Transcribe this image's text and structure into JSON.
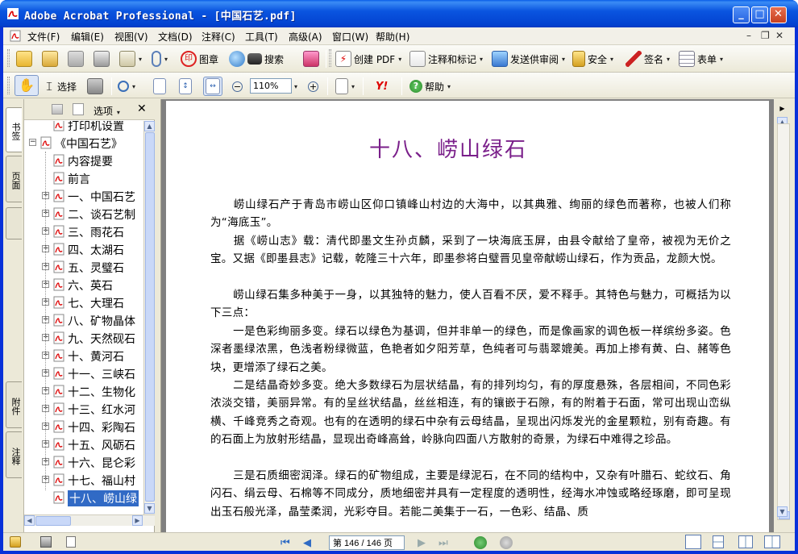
{
  "window": {
    "title": "Adobe Acrobat Professional - [中国石艺.pdf]",
    "controls": {
      "minimize": "_",
      "maximize": "□",
      "close": "✕"
    }
  },
  "menubar": {
    "items": [
      "文件(F)",
      "编辑(E)",
      "视图(V)",
      "文档(D)",
      "注释(C)",
      "工具(T)",
      "高级(A)",
      "窗口(W)",
      "帮助(H)"
    ],
    "mdi_controls": {
      "minimize": "–",
      "restore": "❐",
      "close": "✕"
    }
  },
  "toolbar1": {
    "stamp_label": "图章",
    "search_label": "搜索",
    "create_pdf_label": "创建 PDF",
    "comment_label": "注释和标记",
    "review_label": "发送供审阅",
    "secure_label": "安全",
    "sign_label": "签名",
    "forms_label": "表单"
  },
  "toolbar2": {
    "select_label": "选择",
    "zoom_value": "110%",
    "help_label": "帮助",
    "yahoo_label": "Y!"
  },
  "sidebar_tabs": [
    "书签",
    "页面",
    "附件",
    "注释"
  ],
  "navpane": {
    "options_label": "选项",
    "close_label": "✕",
    "tree": [
      {
        "label": "打印机设置",
        "indent": 1,
        "expander": "",
        "partial": true
      },
      {
        "label": "《中国石艺》",
        "indent": 0,
        "expander": "−"
      },
      {
        "label": "内容提要",
        "indent": 1,
        "expander": ""
      },
      {
        "label": "前言",
        "indent": 1,
        "expander": ""
      },
      {
        "label": "一、中国石艺",
        "indent": 1,
        "expander": "+"
      },
      {
        "label": "二、谈石艺制",
        "indent": 1,
        "expander": "+"
      },
      {
        "label": "三、雨花石",
        "indent": 1,
        "expander": "+"
      },
      {
        "label": "四、太湖石",
        "indent": 1,
        "expander": "+"
      },
      {
        "label": "五、灵璧石",
        "indent": 1,
        "expander": "+"
      },
      {
        "label": "六、英石",
        "indent": 1,
        "expander": "+"
      },
      {
        "label": "七、大理石",
        "indent": 1,
        "expander": "+"
      },
      {
        "label": "八、矿物晶体",
        "indent": 1,
        "expander": "+"
      },
      {
        "label": "九、天然砚石",
        "indent": 1,
        "expander": "+"
      },
      {
        "label": "十、黄河石",
        "indent": 1,
        "expander": "+"
      },
      {
        "label": "十一、三峡石",
        "indent": 1,
        "expander": "+"
      },
      {
        "label": "十二、生物化",
        "indent": 1,
        "expander": "+"
      },
      {
        "label": "十三、红水河",
        "indent": 1,
        "expander": "+"
      },
      {
        "label": "十四、彩陶石",
        "indent": 1,
        "expander": "+"
      },
      {
        "label": "十五、风砺石",
        "indent": 1,
        "expander": "+"
      },
      {
        "label": "十六、昆仑彩",
        "indent": 1,
        "expander": "+"
      },
      {
        "label": "十七、福山村",
        "indent": 1,
        "expander": "+"
      },
      {
        "label": "十八、崂山绿",
        "indent": 1,
        "expander": "",
        "selected": true
      }
    ]
  },
  "document": {
    "heading": "十八、崂山绿石",
    "paragraphs": [
      "　　崂山绿石产于青岛市崂山区仰口镇峰山村边的大海中，以其典雅、绚丽的绿色而著称，也被人们称为“海底玉”。",
      "　　据《崂山志》载：清代即墨文生孙贞麟，采到了一块海底玉屏，由县令献给了皇帝，被视为无价之宝。又据《即墨县志》记载，乾隆三十六年，即墨参将白璧晋见皇帝献崂山绿石，作为贡品，龙颜大悦。",
      "　　崂山绿石集多种美于一身，以其独特的魅力，使人百看不厌，爱不释手。其特色与魅力，可概括为以下三点：",
      "　　一是色彩绚丽多变。绿石以绿色为基调，但并非单一的绿色，而是像画家的调色板一样缤纷多姿。色深者墨绿浓黑，色浅者粉绿微蓝，色艳者如夕阳芳草，色纯者可与翡翠媲美。再加上掺有黄、白、赭等色块，更增添了绿石之美。",
      "　　二是结晶奇妙多变。绝大多数绿石为层状结晶，有的排列均匀，有的厚度悬殊，各层相间，不同色彩浓淡交错，美丽异常。有的呈丝状结晶，丝丝相连，有的镶嵌于石隙，有的附着于石面，常可出现山峦纵横、千峰竞秀之奇观。也有的在透明的绿石中杂有云母结晶，呈现出闪烁发光的金星颗粒，别有奇趣。有的石面上为放射形结晶，显现出奇峰高耸，岭脉向四面八方散射的奇景，为绿石中难得之珍品。",
      "　　三是石质细密润泽。绿石的矿物组成，主要是绿泥石，在不同的结构中，又杂有叶腊石、蛇纹石、角闪石、绢云母、石棉等不同成分，质地细密并具有一定程度的透明性，经海水冲蚀或略经琢磨，即可呈现出玉石般光泽，晶莹柔润，光彩夺目。若能二美集于一石，一色彩、结晶、质"
    ]
  },
  "statusbar": {
    "page_display": "第 146 / 146 页",
    "current_page": 146,
    "total_pages": 146
  },
  "colors": {
    "title_bar": "#0a55e0",
    "heading_color": "#7a1f8a",
    "selection": "#316ac5"
  }
}
